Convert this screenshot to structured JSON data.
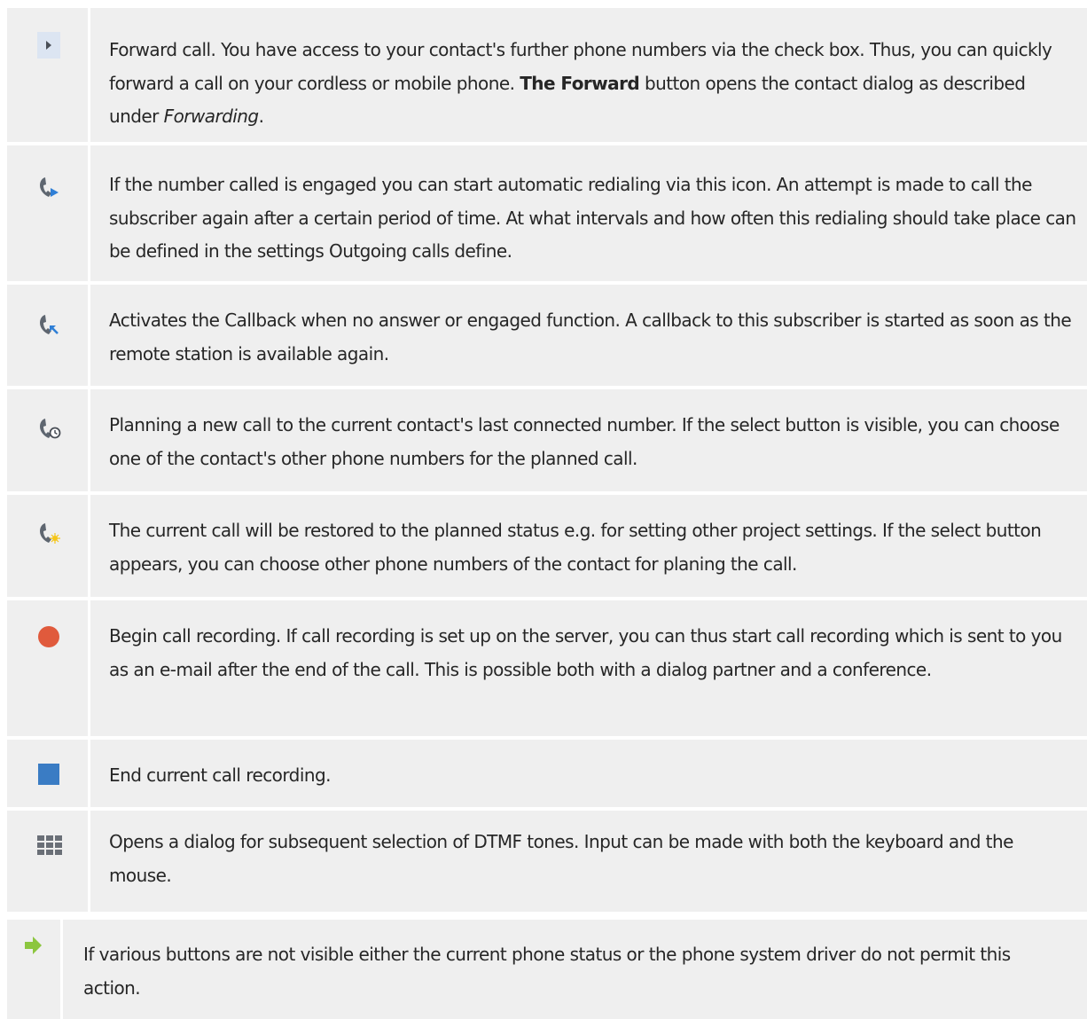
{
  "rows": [
    {
      "icon": "play-arrow-icon",
      "parts": [
        {
          "t": "Forward call. You have access to your contact's further phone numbers via the check box. Thus, you can quickly forward a call on your cordless or mobile phone. "
        },
        {
          "t": "The Forward",
          "b": true
        },
        {
          "t": " button opens the contact dialog as described under "
        },
        {
          "t": "Forwarding",
          "i": true
        },
        {
          "t": "."
        }
      ]
    },
    {
      "icon": "redial-phone-icon",
      "parts": [
        {
          "t": "If the number called is engaged you can start automatic redialing via this icon. An attempt is made to call the subscriber again after a certain period of time. At what intervals and how often this redialing should take place can be defined in the settings Outgoing calls define."
        }
      ]
    },
    {
      "icon": "callback-phone-icon",
      "parts": [
        {
          "t": "Activates the Callback when no answer or engaged function. A callback to this subscriber is started as soon as the remote station is available again."
        }
      ]
    },
    {
      "icon": "scheduled-call-phone-icon",
      "parts": [
        {
          "t": "Planning a new call to the current contact's last connected number. If the select button is visible, you can choose one of the contact's other phone numbers for the planned call."
        }
      ]
    },
    {
      "icon": "restore-planned-phone-icon",
      "parts": [
        {
          "t": "The current call will be restored to the planned status e.g. for setting other project settings. If the select button appears, you can choose other phone numbers of the contact for planing the call."
        }
      ]
    },
    {
      "icon": "record-icon",
      "parts": [
        {
          "t": "Begin call recording. If call recording is set up on the server, you can thus start call recording which is sent to you as an e-mail after the end of the call. This is possible both with a dialog partner and a conference."
        }
      ]
    },
    {
      "icon": "stop-icon",
      "parts": [
        {
          "t": "End current call recording."
        }
      ]
    },
    {
      "icon": "keypad-icon",
      "parts": [
        {
          "t": "Opens a dialog for subsequent selection of DTMF tones. Input can be made with both the keyboard and the mouse."
        }
      ]
    }
  ],
  "note": {
    "icon": "note-arrow-icon",
    "text": "If various buttons are not visible either the current phone status or the phone system driver do not permit this action."
  },
  "colors": {
    "row_background": "#efefef",
    "record_red": "#e05a3c",
    "stop_blue": "#3a7cc4",
    "note_arrow_green": "#8cc63f",
    "phone_gray": "#5e6670",
    "icon_blue": "#2f7fd6"
  }
}
